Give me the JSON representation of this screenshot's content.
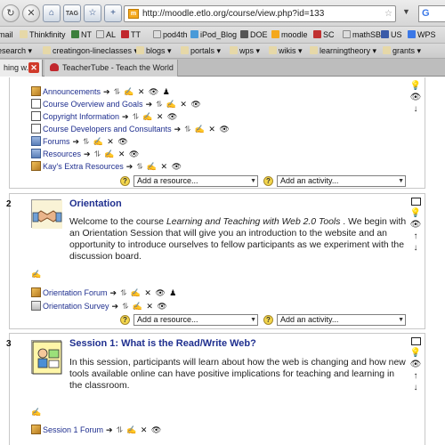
{
  "browser": {
    "url": "http://moodle.etlo.org/course/view.php?id=133",
    "toolbar_icons": [
      "left-arrow-icon",
      "right-arrow-icon",
      "reload-icon",
      "stop-icon",
      "home-icon",
      "tag-icon",
      "bookmark-icon",
      "new-tab-icon"
    ],
    "tag_label": "TAG",
    "search_engine_glyph": "G",
    "bookmarks_row1": [
      "mail",
      "Thinkfinity",
      "NT",
      "AL",
      "TT",
      "pod4th",
      "iPod_Blog",
      "DOE",
      "moodle",
      "SC",
      "mathSB",
      "US",
      "WPS"
    ],
    "bookmarks_row2": [
      "esearch",
      "creatingon-lineclasses",
      "blogs",
      "portals",
      "wps",
      "wikis",
      "learningtheory",
      "grants"
    ],
    "tabs": [
      {
        "label": "hing w..."
      },
      {
        "label": "TeacherTube - Teach the World"
      }
    ]
  },
  "section0": {
    "resources": [
      {
        "label": "Announcements",
        "icon": "forum-icon",
        "controls": "➔ ⥮ ✍ ✕ 👁 ♟"
      },
      {
        "label": "Course Overview and Goals",
        "icon": "document-icon",
        "controls": "➔ ⥮ ✍ ✕ 👁"
      },
      {
        "label": "Copyright Information",
        "icon": "document-icon",
        "controls": "➔ ⥮ ✍ ✕ 👁"
      },
      {
        "label": "Course Developers and Consultants",
        "icon": "document-icon",
        "controls": "➔ ⥮ ✍ ✕ 👁"
      },
      {
        "label": "Forums",
        "icon": "folder-icon",
        "controls": "➔ ⥮ ✍ ✕ 👁"
      },
      {
        "label": "Resources",
        "icon": "folder-icon",
        "controls": "➔ ⥮ ✍ ✕ 👁"
      },
      {
        "label": "Kay's Extra Resources",
        "icon": "forum-icon",
        "controls": "➔ ⥮ ✍ ✕ 👁"
      }
    ],
    "add_resource": "Add a resource...",
    "add_activity": "Add an activity..."
  },
  "section2": {
    "number": "2",
    "title": "Orientation",
    "text_pre": "Welcome to the course ",
    "text_em": "Learning and Teaching with Web 2.0 Tools",
    "text_post": " . We begin with an Orientation Session that will give you an introduction to the website and an opportunity to introduce ourselves to fellow participants as we experiment with the discussion board.",
    "resources": [
      {
        "label": "Orientation Forum",
        "icon": "forum-icon",
        "controls": "➔ ⥮ ✍ ✕ 👁 ♟"
      },
      {
        "label": "Orientation Survey",
        "icon": "survey-icon",
        "controls": "➔ ⥮ ✍ ✕ 👁"
      }
    ],
    "add_resource": "Add a resource...",
    "add_activity": "Add an activity..."
  },
  "section3": {
    "number": "3",
    "title": "Session 1: What is the Read/Write Web?",
    "text": "In this session, participants will learn about how the web is changing and how new tools available online can have positive implications for teaching and learning in the classroom.",
    "resources": [
      {
        "label": "Session 1 Forum",
        "icon": "forum-icon",
        "controls": "➔ ⥮ ✍ ✕ 👁"
      }
    ]
  },
  "glyphs": {
    "dropdown_arrow": "▼",
    "help": "?",
    "lightbulb": "💡",
    "eye": "👁",
    "arrow_up": "↑",
    "arrow_down": "↓",
    "pencil": "✍",
    "star": "☆",
    "close": "✕"
  }
}
